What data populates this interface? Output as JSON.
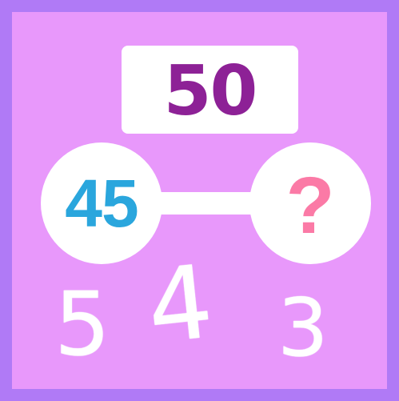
{
  "puzzle": {
    "total": "50",
    "known_part": "45",
    "unknown_part": "?"
  },
  "choices": [
    {
      "label": "5"
    },
    {
      "label": "4"
    },
    {
      "label": "3"
    }
  ],
  "colors": {
    "border": "#b07af6",
    "background": "#e898fb",
    "total_text": "#8d2196",
    "known_part_text": "#2aa6dd",
    "unknown_text": "#fb7aa6",
    "choice_text": "#ffffff"
  }
}
